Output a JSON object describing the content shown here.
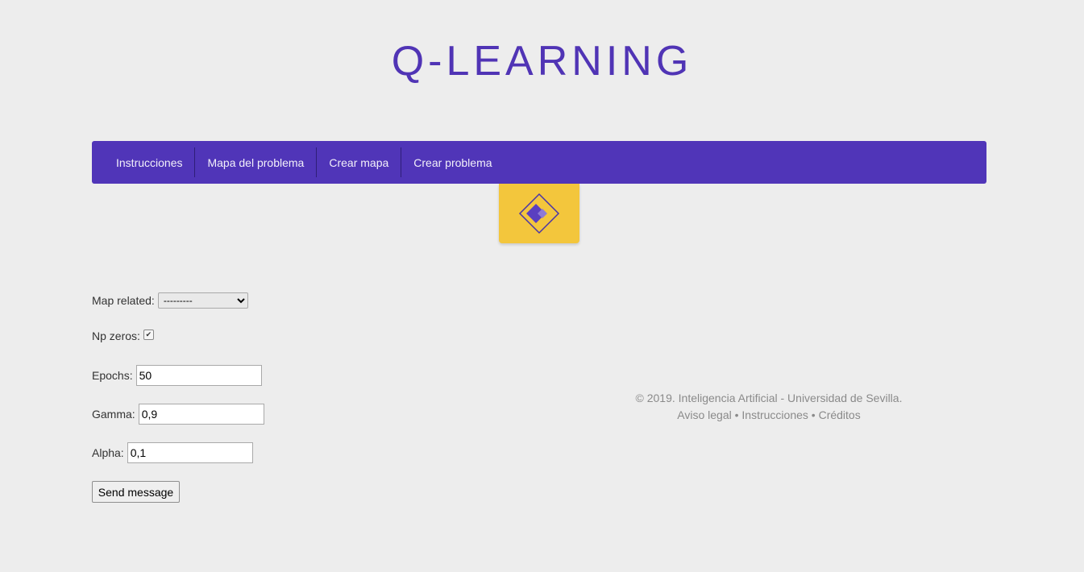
{
  "header": {
    "title": "Q-LEARNING"
  },
  "nav": {
    "items": [
      {
        "label": "Instrucciones"
      },
      {
        "label": "Mapa del problema"
      },
      {
        "label": "Crear mapa"
      },
      {
        "label": "Crear problema"
      }
    ]
  },
  "form": {
    "map_related": {
      "label": "Map related:",
      "selected": "---------"
    },
    "np_zeros": {
      "label": "Np zeros:",
      "checked": true
    },
    "epochs": {
      "label": "Epochs:",
      "value": "50"
    },
    "gamma": {
      "label": "Gamma:",
      "value": "0,9"
    },
    "alpha": {
      "label": "Alpha:",
      "value": "0,1"
    },
    "submit_label": "Send message"
  },
  "footer": {
    "copyright": "© 2019. Inteligencia Artificial - Universidad de Sevilla.",
    "links": [
      "Aviso legal",
      "Instrucciones",
      "Créditos"
    ],
    "separator": "•"
  },
  "colors": {
    "brand_purple": "#5035b8",
    "logo_yellow": "#f3c63c",
    "background": "#ededed"
  }
}
